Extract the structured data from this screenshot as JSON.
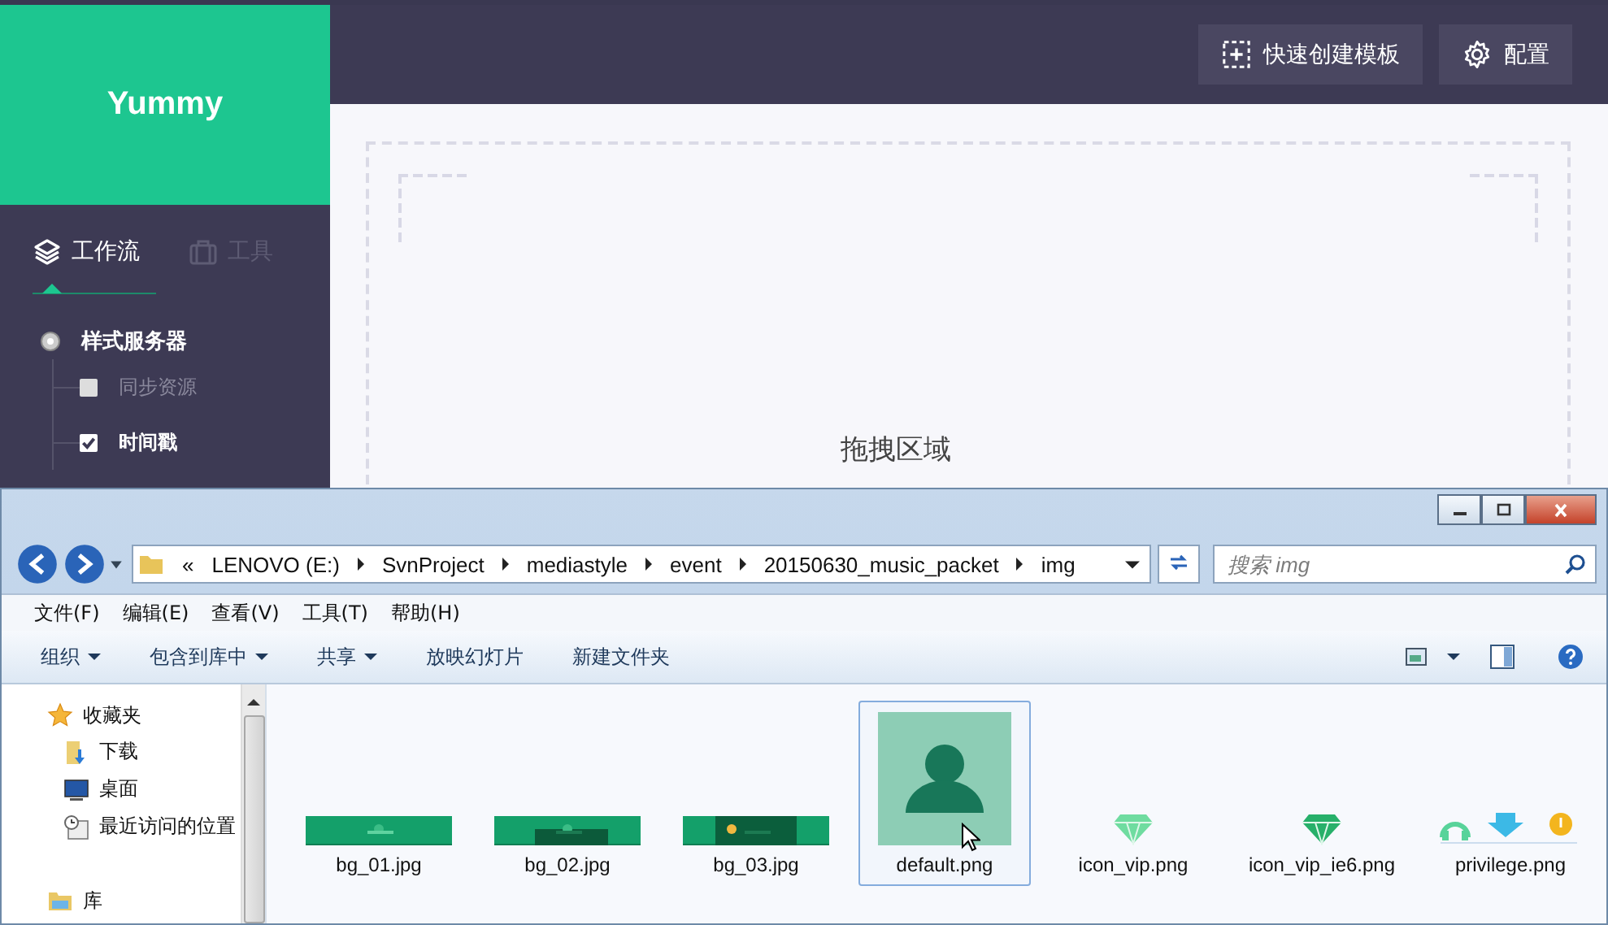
{
  "app": {
    "logo": "Yummy",
    "header_buttons": [
      {
        "label": "快速创建模板",
        "kind": "add"
      },
      {
        "label": "配置",
        "kind": "settings"
      }
    ],
    "sidebar_tabs": [
      {
        "label": "工作流",
        "kind": "layers",
        "selected": true
      },
      {
        "label": "工具",
        "kind": "toolbox",
        "selected": false
      }
    ],
    "tree": [
      {
        "label": "样式服务器",
        "children": [
          {
            "label": "同步资源",
            "checked": false
          },
          {
            "label": "时间戳",
            "checked": true
          }
        ]
      }
    ],
    "drop_zone": {
      "title": "拖拽区域"
    }
  },
  "explorer": {
    "breadcrumb_overflow": "«",
    "breadcrumb": [
      "LENOVO (E:)",
      "SvnProject",
      "mediastyle",
      "event",
      "20150630_music_packet",
      "img"
    ],
    "search": {
      "placeholder": "搜索 img"
    },
    "menu": [
      "文件(F)",
      "编辑(E)",
      "查看(V)",
      "工具(T)",
      "帮助(H)"
    ],
    "toolbar": [
      {
        "label": "组织",
        "dropdown": true
      },
      {
        "label": "包含到库中",
        "dropdown": true
      },
      {
        "label": "共享",
        "dropdown": true
      },
      {
        "label": "放映幻灯片",
        "dropdown": false
      },
      {
        "label": "新建文件夹",
        "dropdown": false
      }
    ],
    "nav": [
      {
        "label": "收藏夹",
        "kind": "star",
        "children": [
          {
            "label": "下载",
            "kind": "download"
          },
          {
            "label": "桌面",
            "kind": "desktop"
          },
          {
            "label": "最近访问的位置",
            "kind": "recent"
          }
        ]
      },
      {
        "label": "库",
        "kind": "library"
      }
    ],
    "files": [
      {
        "name": "bg_01.jpg",
        "kind": "banner",
        "selected": false
      },
      {
        "name": "bg_02.jpg",
        "kind": "banner",
        "selected": false
      },
      {
        "name": "bg_03.jpg",
        "kind": "banner",
        "selected": false
      },
      {
        "name": "default.png",
        "kind": "avatar",
        "selected": true
      },
      {
        "name": "icon_vip.png",
        "kind": "gem",
        "selected": false
      },
      {
        "name": "icon_vip_ie6.png",
        "kind": "gem",
        "selected": false
      },
      {
        "name": "privilege.png",
        "kind": "badges",
        "selected": false
      }
    ]
  }
}
